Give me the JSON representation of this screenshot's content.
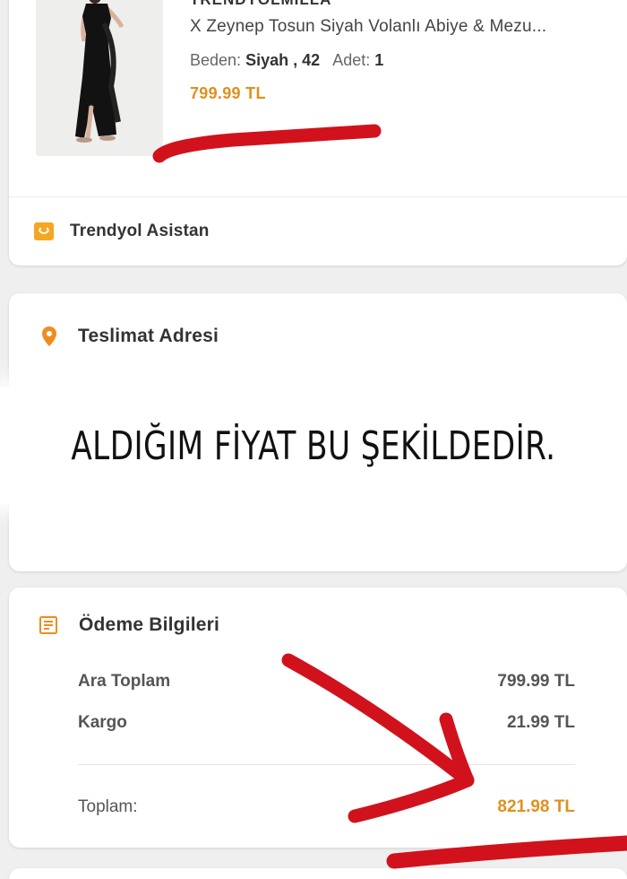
{
  "product": {
    "seller": "TRENDYOLMİLLA",
    "title": "X Zeynep Tosun Siyah Volanlı Abiye & Mezu...",
    "variant_label_size": "Beden:",
    "variant_color": "Siyah",
    "variant_size": "42",
    "variant_label_qty": "Adet:",
    "variant_qty": "1",
    "price": "799.99 TL"
  },
  "assistant": {
    "label": "Trendyol Asistan",
    "icon": "chat-bubble-icon"
  },
  "address": {
    "title": "Teslimat Adresi",
    "icon": "location-pin-icon"
  },
  "overlay": {
    "text": "ALDIĞIM FİYAT BU ŞEKİLDEDİR."
  },
  "payment": {
    "title": "Ödeme Bilgileri",
    "icon": "receipt-icon",
    "subtotal_label": "Ara Toplam",
    "subtotal_value": "799.99 TL",
    "shipping_label": "Kargo",
    "shipping_value": "21.99 TL",
    "total_label": "Toplam:",
    "total_value": "821.98 TL"
  },
  "colors": {
    "accent": "#e0901f",
    "annotation": "#d1121c",
    "background": "#efefef"
  }
}
